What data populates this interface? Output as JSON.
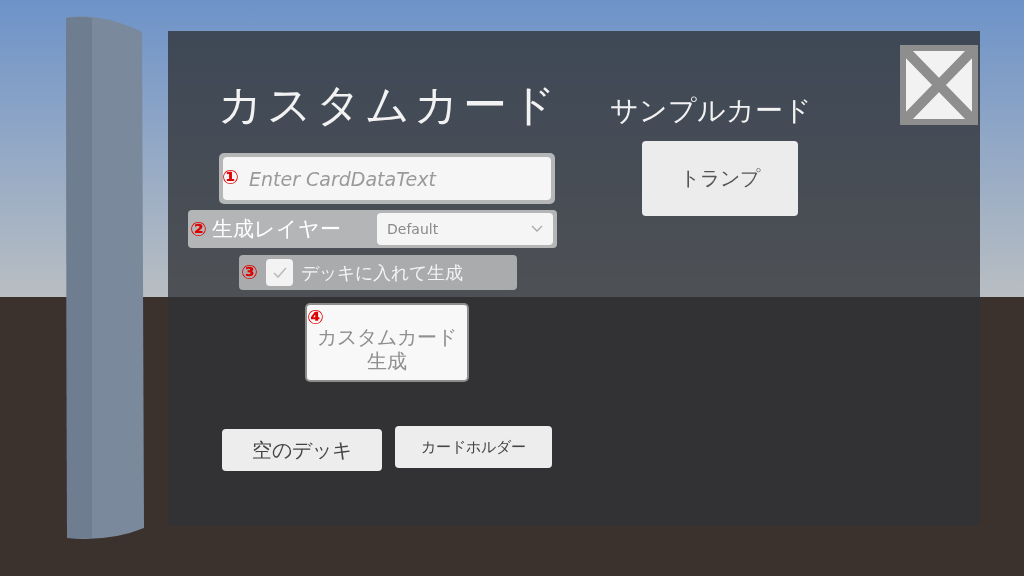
{
  "custom_card": {
    "title": "カスタムカード",
    "card_data_field": {
      "marker": "①",
      "placeholder": "Enter CardDataText"
    },
    "layer": {
      "marker": "②",
      "label": "生成レイヤー",
      "dropdown_value": "Default"
    },
    "add_to_deck": {
      "marker": "③",
      "label": "デッキに入れて生成",
      "checked": true
    },
    "generate_button": {
      "marker": "④",
      "label": "カスタムカード生成",
      "disabled": true
    },
    "bottom_buttons": [
      "空のデッキ",
      "カードホルダー"
    ]
  },
  "sample_cards": {
    "title": "サンプルカード",
    "buttons": [
      "トランプ"
    ]
  }
}
